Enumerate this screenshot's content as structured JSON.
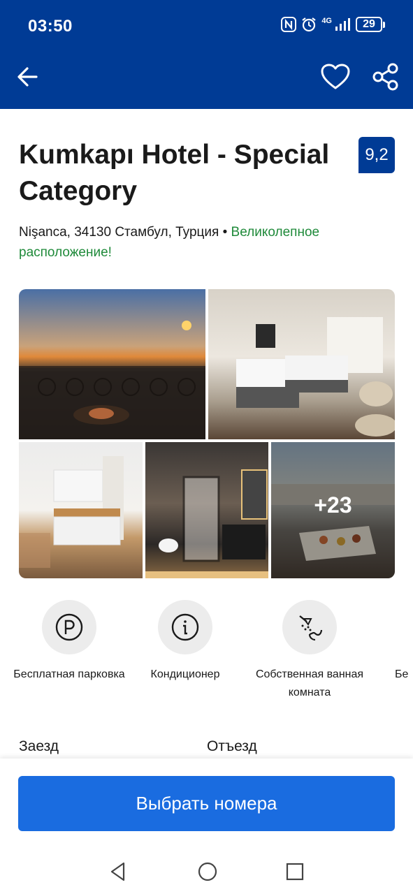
{
  "status_bar": {
    "time": "03:50",
    "network": "4G",
    "battery": "29",
    "icons": [
      "nfc-icon",
      "alarm-icon",
      "signal-icon",
      "battery-icon"
    ]
  },
  "toolbar": {
    "icons": [
      "arrow-back-icon",
      "heart-icon",
      "share-icon"
    ]
  },
  "hotel": {
    "name": "Kumkapı Hotel - Special Category",
    "score": "9,2",
    "address": "Nişanca, 34130 Стамбул, Турция",
    "separator": " • ",
    "location_note": "Великолепное расположение!"
  },
  "gallery": {
    "more_count": "+23"
  },
  "facilities": [
    {
      "label": "Бесплатная парковка",
      "icon": "parking-icon"
    },
    {
      "label": "Кондиционер",
      "icon": "info-icon"
    },
    {
      "label": "Собственная ванная комната",
      "icon": "shower-icon"
    },
    {
      "label": "Бе",
      "icon": ""
    }
  ],
  "dates": {
    "checkin_label": "Заезд",
    "checkout_label": "Отъезд"
  },
  "cta": {
    "label": "Выбрать номера"
  },
  "colors": {
    "brand": "#003b95",
    "button": "#1a6ce0",
    "accent_green": "#1f8a3a"
  },
  "system_nav": {
    "icons": [
      "nav-back-icon",
      "nav-home-icon",
      "nav-recent-icon"
    ]
  }
}
